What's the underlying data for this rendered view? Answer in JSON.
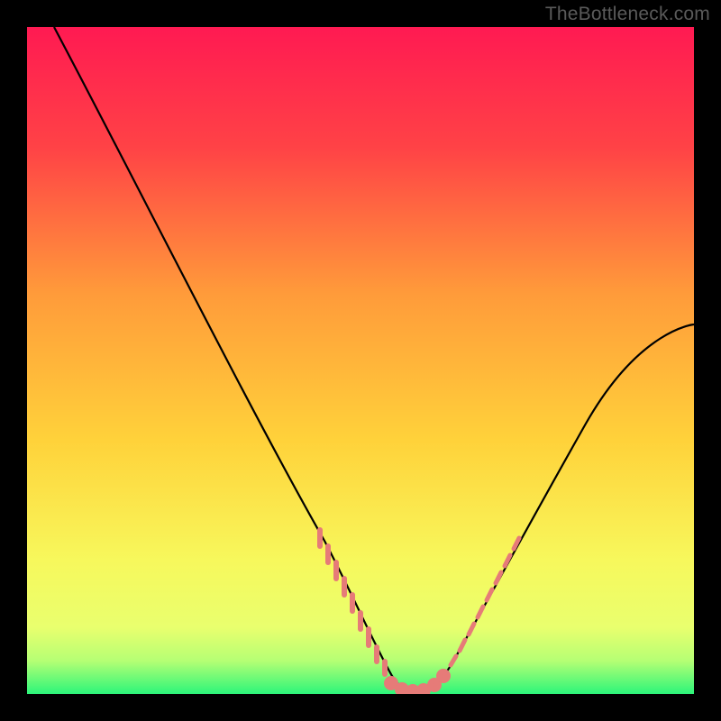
{
  "watermark": "TheBottleneck.com",
  "colors": {
    "bg": "#000000",
    "gradient_top": "#ff1a52",
    "gradient_mid": "#ffd740",
    "gradient_low": "#f7ff6e",
    "gradient_bottom": "#2cf57a",
    "curve": "#000000",
    "markers": "#e67b78",
    "watermark": "#5a5a5a"
  },
  "chart_data": {
    "type": "line",
    "title": "",
    "xlabel": "",
    "ylabel": "",
    "xlim": [
      0,
      100
    ],
    "ylim": [
      0,
      100
    ],
    "series": [
      {
        "name": "bottleneck-curve",
        "x": [
          4,
          8,
          12,
          16,
          20,
          24,
          28,
          32,
          36,
          40,
          44,
          48,
          50,
          52,
          54,
          56,
          58,
          60,
          62,
          64,
          68,
          72,
          76,
          80,
          84,
          88,
          92,
          96,
          100
        ],
        "values": [
          100,
          93,
          86,
          79,
          72,
          65,
          58,
          51,
          44,
          37,
          30,
          22,
          17,
          11,
          6,
          2,
          0,
          1,
          3,
          6,
          12,
          18,
          24,
          30,
          36,
          42,
          48,
          52,
          55
        ]
      }
    ],
    "markers_dense": {
      "name": "left-cluster",
      "approximate_range_x": [
        44,
        62
      ],
      "approximate_range_y": [
        0,
        30
      ]
    },
    "markers_sparse": {
      "name": "right-cluster",
      "approximate_range_x": [
        62,
        72
      ],
      "approximate_range_y": [
        3,
        18
      ]
    }
  }
}
